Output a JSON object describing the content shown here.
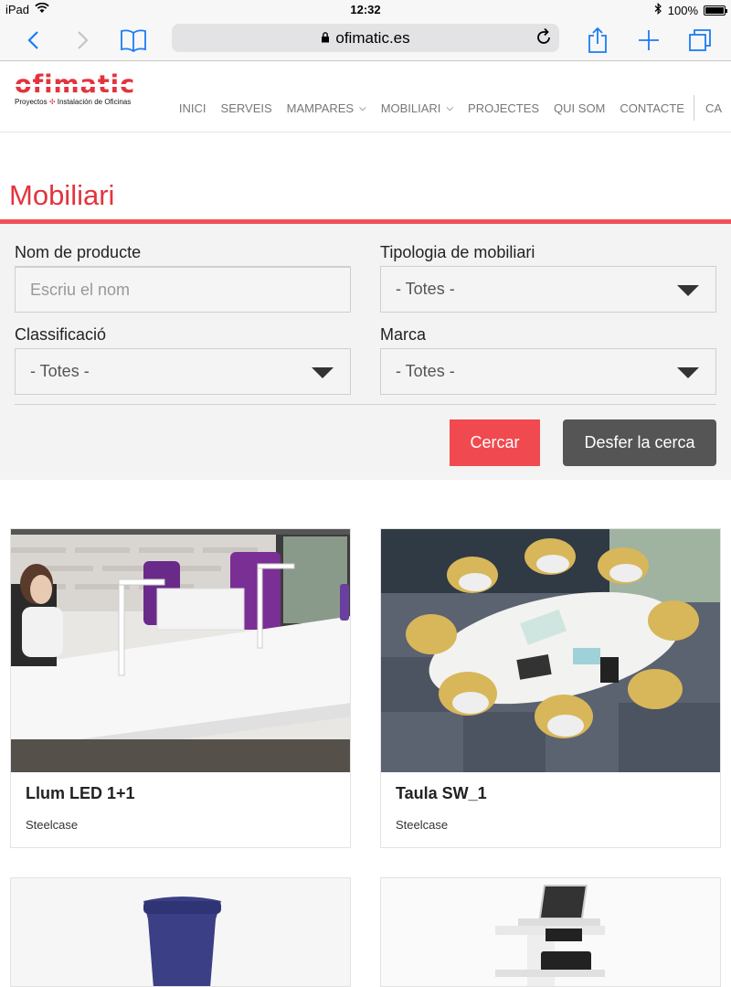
{
  "statusbar": {
    "device": "iPad",
    "time": "12:32",
    "battery": "100%",
    "battery_level": 1.0
  },
  "browser": {
    "url": "ofimatic.es"
  },
  "site": {
    "logo": "ofimatic",
    "tagline_part1": "Proyectos",
    "tagline_part2": "Instalación de Oficinas",
    "nav": [
      "INICI",
      "SERVEIS",
      "MAMPARES",
      "MOBILIARI",
      "PROJECTES",
      "QUI SOM",
      "CONTACTE",
      "CA"
    ]
  },
  "page": {
    "title": "Mobiliari"
  },
  "filters": {
    "name_label": "Nom de producte",
    "name_placeholder": "Escriu el nom",
    "type_label": "Tipologia de mobiliari",
    "type_value": "- Totes -",
    "class_label": "Classificació",
    "class_value": "- Totes -",
    "brand_label": "Marca",
    "brand_value": "- Totes -",
    "search_button": "Cercar",
    "reset_button": "Desfer la cerca"
  },
  "products": [
    {
      "name": "Llum LED 1+1",
      "brand": "Steelcase"
    },
    {
      "name": "Taula SW_1",
      "brand": "Steelcase"
    }
  ],
  "colors": {
    "accent": "#e3343d",
    "button_red": "#f04a50",
    "button_grey": "#555555",
    "panel": "#f3f3f3"
  }
}
